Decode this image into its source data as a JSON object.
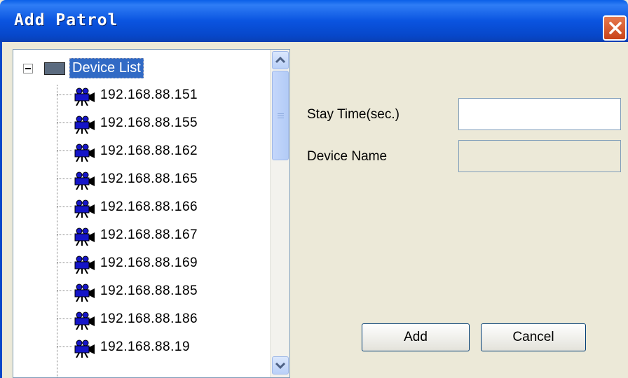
{
  "window": {
    "title": "Add Patrol"
  },
  "tree": {
    "root_label": "Device List",
    "devices": [
      "192.168.88.151",
      "192.168.88.155",
      "192.168.88.162",
      "192.168.88.165",
      "192.168.88.166",
      "192.168.88.167",
      "192.168.88.169",
      "192.168.88.185",
      "192.168.88.186",
      "192.168.88.19"
    ]
  },
  "form": {
    "stay_time_label": "Stay Time(sec.)",
    "stay_time_value": "",
    "device_name_label": "Device Name",
    "device_name_value": ""
  },
  "buttons": {
    "add": "Add",
    "cancel": "Cancel"
  },
  "colors": {
    "titlebar": "#0a54e0",
    "selection": "#316ac5",
    "dialog_bg": "#ece9d8",
    "camera_blue": "#1515c8"
  }
}
